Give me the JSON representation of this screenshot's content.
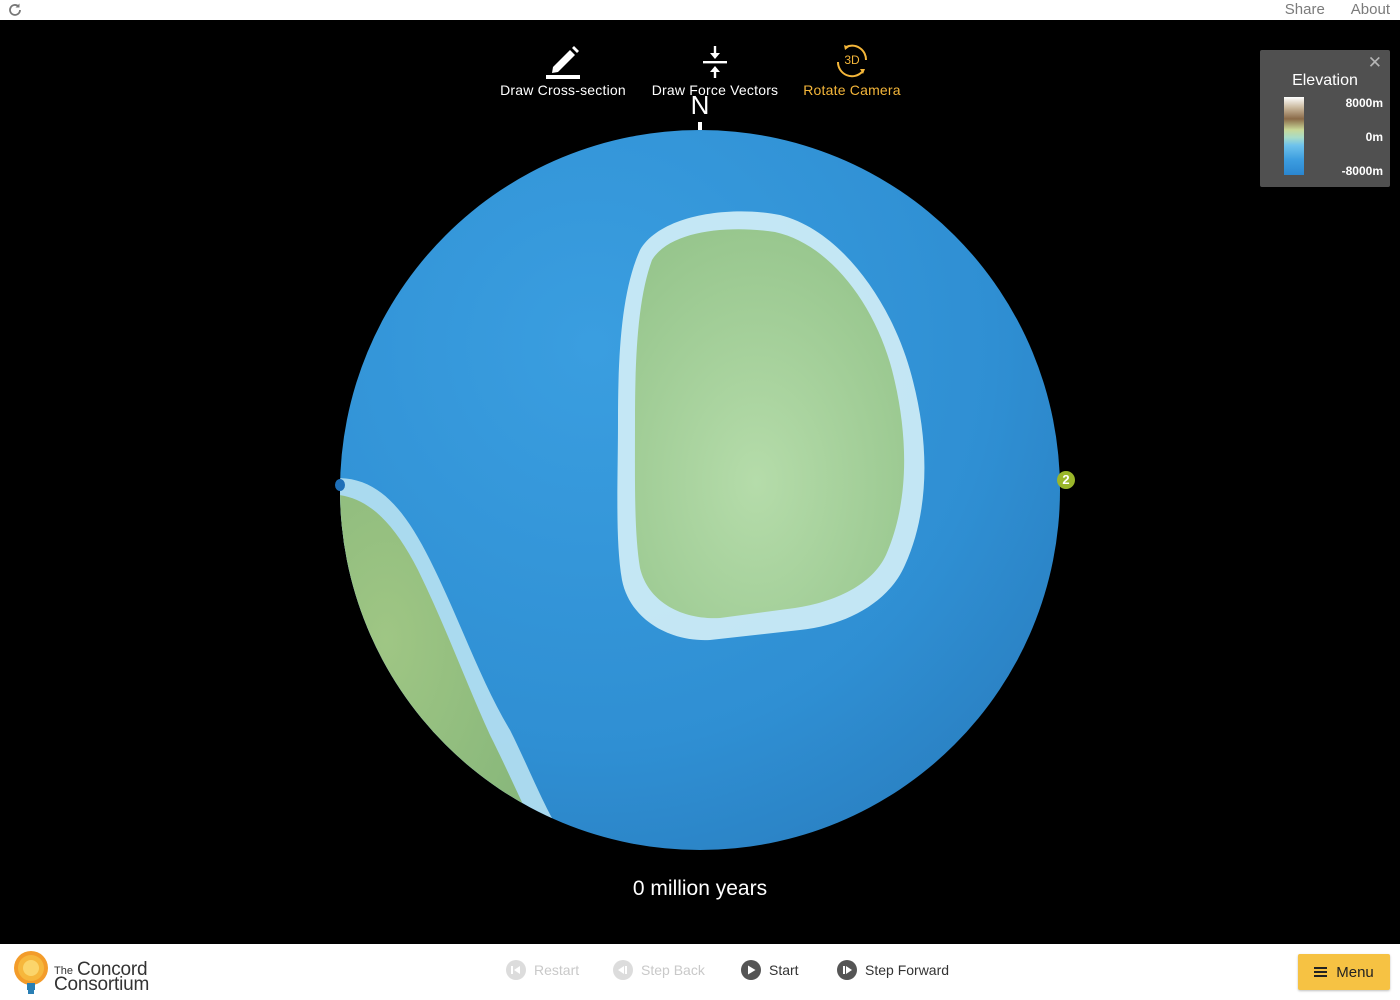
{
  "topbar": {
    "share_label": "Share",
    "about_label": "About"
  },
  "tools": [
    {
      "label": "Draw Cross-section",
      "icon": "pencil-icon",
      "active": false
    },
    {
      "label": "Draw Force Vectors",
      "icon": "force-vectors-icon",
      "active": false
    },
    {
      "label": "Rotate Camera",
      "icon": "rotate-3d-icon",
      "icon_text": "3D",
      "active": true
    }
  ],
  "compass": {
    "north_label": "N"
  },
  "plate_marker": {
    "label": "2"
  },
  "age": {
    "text": "0 million years"
  },
  "legend": {
    "title": "Elevation",
    "close_glyph": "✕",
    "max_label": "8000m",
    "mid_label": "0m",
    "min_label": "-8000m"
  },
  "logo": {
    "the": "The",
    "line1": "Concord",
    "line2": "Consortium"
  },
  "controls": {
    "restart": {
      "label": "Restart",
      "enabled": false
    },
    "step_back": {
      "label": "Step Back",
      "enabled": false
    },
    "start": {
      "label": "Start",
      "enabled": true
    },
    "step_forward": {
      "label": "Step Forward",
      "enabled": true
    }
  },
  "menu": {
    "label": "Menu"
  },
  "colors": {
    "ocean": "#3596da",
    "continent": "#9fcb93",
    "shelf": "#d6f3f8",
    "accent": "#f4b63a",
    "menu_button": "#f6c243"
  }
}
